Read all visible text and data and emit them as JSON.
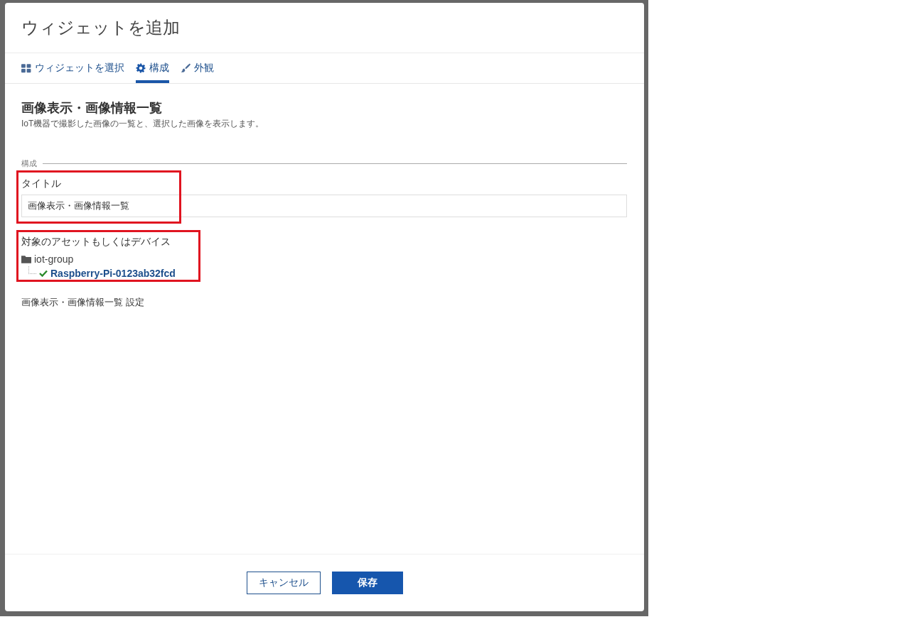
{
  "dialog": {
    "title": "ウィジェットを追加"
  },
  "tabs": [
    {
      "label": "ウィジェットを選択",
      "selected": false
    },
    {
      "label": "構成",
      "selected": true
    },
    {
      "label": "外観",
      "selected": false
    }
  ],
  "widget": {
    "heading": "画像表示・画像情報一覧",
    "description": "IoT機器で撮影した画像の一覧と、選択した画像を表示します。"
  },
  "section_label": "構成",
  "title_field": {
    "label": "タイトル",
    "value": "画像表示・画像情報一覧"
  },
  "target": {
    "label": "対象のアセットもしくはデバイス",
    "tree": [
      {
        "label": "iot-group",
        "children": [
          {
            "label": "Raspberry-Pi-0123ab32fcd",
            "selected": true
          }
        ]
      }
    ]
  },
  "settings_label": "画像表示・画像情報一覧 設定",
  "buttons": [
    {
      "label": "キャンセル",
      "kind": "secondary"
    },
    {
      "label": "保存",
      "kind": "primary"
    }
  ]
}
